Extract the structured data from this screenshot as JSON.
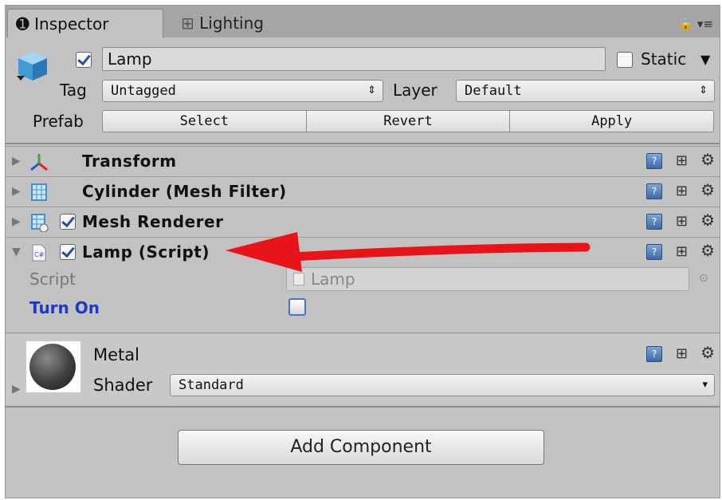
{
  "tabs": [
    {
      "label": "Inspector"
    },
    {
      "label": "Lighting"
    }
  ],
  "tab_icons": {
    "inspector": "info-icon",
    "lighting": "lighting-sliders-icon"
  },
  "tabbar_right": {
    "lock": "lock-icon",
    "menu": "menu-icon"
  },
  "object": {
    "name": "Lamp",
    "active": true,
    "static_label": "Static",
    "static_checked": false
  },
  "tag": {
    "label": "Tag",
    "value": "Untagged"
  },
  "layer": {
    "label": "Layer",
    "value": "Default"
  },
  "prefab": {
    "label": "Prefab",
    "buttons": [
      "Select",
      "Revert",
      "Apply"
    ]
  },
  "components": [
    {
      "title": "Transform",
      "icon": "transform-axes-icon",
      "has_checkbox": false,
      "expanded": false
    },
    {
      "title": "Cylinder (Mesh Filter)",
      "icon": "mesh-filter-icon",
      "has_checkbox": false,
      "expanded": false
    },
    {
      "title": "Mesh Renderer",
      "icon": "mesh-renderer-icon",
      "has_checkbox": true,
      "checked": true,
      "expanded": false
    },
    {
      "title": "Lamp (Script)",
      "icon": "csharp-script-icon",
      "has_checkbox": true,
      "checked": true,
      "expanded": true
    }
  ],
  "script_props": {
    "script_label": "Script",
    "script_value": "Lamp",
    "turn_on_label": "Turn On",
    "turn_on_checked": false
  },
  "material": {
    "name": "Metal",
    "shader_label": "Shader",
    "shader_value": "Standard"
  },
  "add_component_label": "Add Component",
  "annotation_arrow_color": "#e8141a",
  "accent_blue": "#1a3bc4"
}
